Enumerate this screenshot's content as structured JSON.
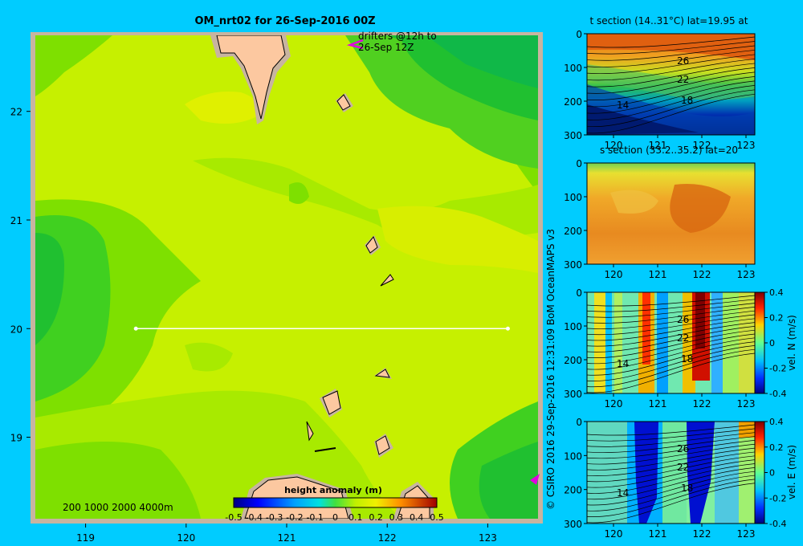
{
  "chart_data": [
    {
      "type": "heatmap",
      "title": "OM_nrt02 for 26-Sep-2016 00Z",
      "annotation": "drifters @12h to 26-Sep 12Z",
      "x_ticks": [
        119,
        120,
        121,
        122,
        123
      ],
      "y_ticks": [
        19,
        20,
        21,
        22
      ],
      "xlim": [
        118.5,
        123.5
      ],
      "ylim": [
        18.25,
        22.7
      ],
      "section_line": {
        "lat": 20,
        "lon_start": 119.5,
        "lon_end": 123.2
      },
      "depth_scale_label": "200  1000  2000  4000m",
      "colorbar": {
        "label": "height anomaly  (m)",
        "ticks": [
          "-0.5",
          "-0.4",
          "-0.3",
          "-0.2",
          "-0.1",
          "0",
          "0.1",
          "0.2",
          "0.3",
          "0.4",
          "0.5"
        ],
        "range": [
          -0.5,
          0.5
        ]
      }
    },
    {
      "type": "heatmap",
      "title": "t section (14..31°C) lat=19.95 at",
      "x_ticks": [
        120,
        121,
        122,
        123
      ],
      "y_ticks": [
        0,
        100,
        200,
        300
      ],
      "contour_labels": [
        "26",
        "22",
        "18",
        "14"
      ],
      "ylim": [
        300,
        0
      ]
    },
    {
      "type": "heatmap",
      "title": "s section (33.2..35.2) lat=20",
      "x_ticks": [
        120,
        121,
        122,
        123
      ],
      "y_ticks": [
        0,
        100,
        200,
        300
      ],
      "ylim": [
        300,
        0
      ]
    },
    {
      "type": "heatmap",
      "x_ticks": [
        120,
        121,
        122,
        123
      ],
      "y_ticks": [
        0,
        100,
        200,
        300
      ],
      "contour_labels": [
        "26",
        "22",
        "18",
        "14"
      ],
      "colorbar": {
        "label": "vel. N (m/s)",
        "ticks": [
          "0.4",
          "0.2",
          "0",
          "-0.2",
          "-0.4"
        ],
        "range": [
          -0.4,
          0.4
        ]
      }
    },
    {
      "type": "heatmap",
      "x_ticks": [
        120,
        121,
        122,
        123
      ],
      "y_ticks": [
        0,
        100,
        200,
        300
      ],
      "contour_labels": [
        "26",
        "22",
        "18",
        "14"
      ],
      "colorbar": {
        "label": "vel. E (m/s)",
        "ticks": [
          "0.4",
          "0.2",
          "0",
          "-0.2",
          "-0.4"
        ],
        "range": [
          -0.4,
          0.4
        ]
      }
    }
  ],
  "credit": "© CSIRO 2016   29-Sep-2016 12:31:09 BoM OceanMAPS v3",
  "colors": {
    "background": "#00ccff",
    "land": "#fcc8a0",
    "coast_frame": "#c8b4a0"
  }
}
